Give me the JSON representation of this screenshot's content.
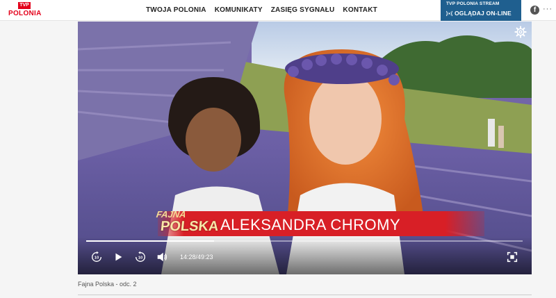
{
  "brand": {
    "tvp": "TVP",
    "name": "POLONIA"
  },
  "nav": [
    {
      "label": "TWOJA POLONIA"
    },
    {
      "label": "KOMUNIKATY"
    },
    {
      "label": "ZASIĘG SYGNAŁU"
    },
    {
      "label": "KONTAKT"
    }
  ],
  "stream": {
    "title": "TVP POLONIA STREAM",
    "button": "OGLĄDAJ ON-LINE"
  },
  "social": {
    "facebook": "f",
    "more": "···"
  },
  "player": {
    "caption_show_line1": "FAJNA",
    "caption_show_line2": "POLSKA",
    "caption_person": "ALEKSANDRA CHROMY",
    "time": "14:28/49:23",
    "progress": 0.293,
    "icons": [
      "settings-icon",
      "rewind-10-icon",
      "play-icon",
      "forward-10-icon",
      "volume-icon",
      "fullscreen-icon"
    ]
  },
  "episode_title": "Fajna Polska - odc. 2",
  "colors": {
    "brand_red": "#e3001b",
    "stream_blue": "#1f5f8f",
    "caption_red": "#d81f26"
  }
}
